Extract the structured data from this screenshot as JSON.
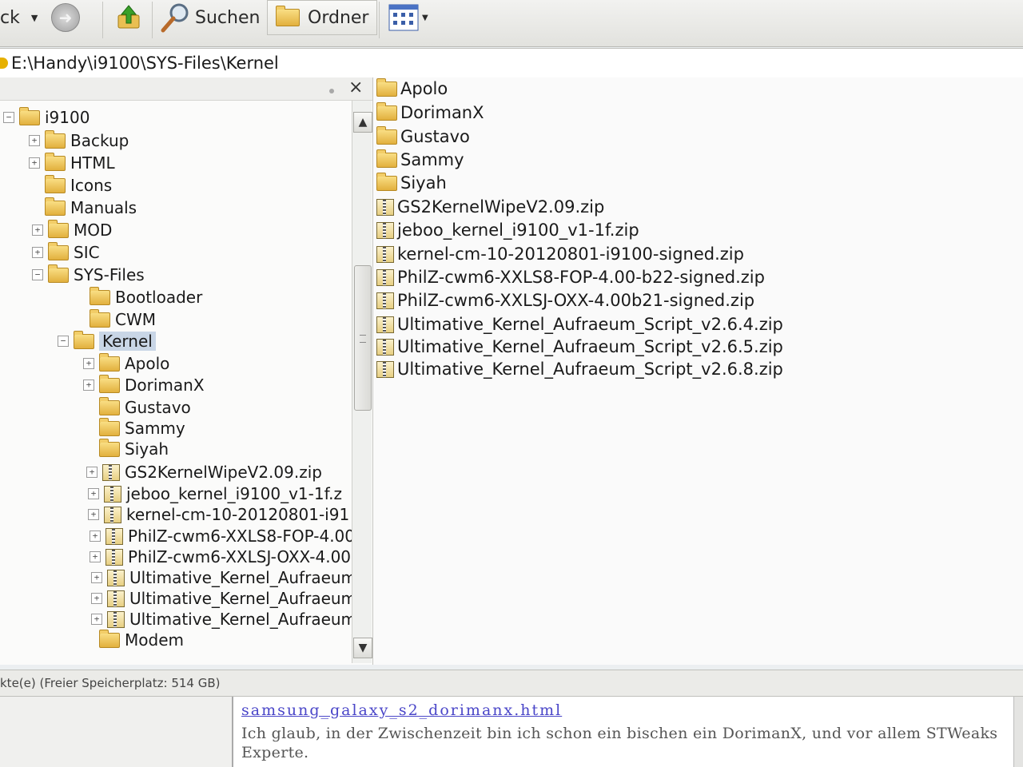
{
  "toolbar": {
    "back_fragment": "ck",
    "search_label": "Suchen",
    "folders_label": "Ordner",
    "icons": {
      "back_dropdown": "chevron-down-icon",
      "forward": "forward-arrow-icon",
      "up": "folder-up-icon",
      "search": "magnifier-icon",
      "folders": "folder-icon",
      "views": "view-grid-icon"
    }
  },
  "address": {
    "path": "E:\\Handy\\i9100\\SYS-Files\\Kernel"
  },
  "folder_pane": {
    "close_glyph": "×",
    "tree": [
      {
        "label": "i9100",
        "expander": "−",
        "type": "folder"
      },
      {
        "label": "Backup",
        "expander": "+",
        "type": "folder"
      },
      {
        "label": "HTML",
        "expander": "+",
        "type": "folder"
      },
      {
        "label": "Icons",
        "expander": "",
        "type": "folder"
      },
      {
        "label": "Manuals",
        "expander": "",
        "type": "folder"
      },
      {
        "label": "MOD",
        "expander": "+",
        "type": "folder"
      },
      {
        "label": "SIC",
        "expander": "+",
        "type": "folder"
      },
      {
        "label": "SYS-Files",
        "expander": "−",
        "type": "folder"
      },
      {
        "label": "Bootloader",
        "expander": "",
        "type": "folder"
      },
      {
        "label": "CWM",
        "expander": "",
        "type": "folder"
      },
      {
        "label": "Kernel",
        "expander": "−",
        "type": "folder",
        "selected": true
      },
      {
        "label": "Apolo",
        "expander": "+",
        "type": "folder"
      },
      {
        "label": "DorimanX",
        "expander": "+",
        "type": "folder"
      },
      {
        "label": "Gustavo",
        "expander": "",
        "type": "folder"
      },
      {
        "label": "Sammy",
        "expander": "",
        "type": "folder"
      },
      {
        "label": "Siyah",
        "expander": "",
        "type": "folder"
      },
      {
        "label": "GS2KernelWipeV2.09.zip",
        "expander": "+",
        "type": "zip"
      },
      {
        "label": "jeboo_kernel_i9100_v1-1f.z",
        "expander": "+",
        "type": "zip"
      },
      {
        "label": "kernel-cm-10-20120801-i91",
        "expander": "+",
        "type": "zip"
      },
      {
        "label": "PhilZ-cwm6-XXLS8-FOP-4.00",
        "expander": "+",
        "type": "zip"
      },
      {
        "label": "PhilZ-cwm6-XXLSJ-OXX-4.00",
        "expander": "+",
        "type": "zip"
      },
      {
        "label": "Ultimative_Kernel_Aufraeum",
        "expander": "+",
        "type": "zip"
      },
      {
        "label": "Ultimative_Kernel_Aufraeum",
        "expander": "+",
        "type": "zip"
      },
      {
        "label": "Ultimative_Kernel_Aufraeum",
        "expander": "+",
        "type": "zip"
      },
      {
        "label": "Modem",
        "expander": "",
        "type": "folder"
      }
    ]
  },
  "file_list": [
    {
      "name": "Apolo",
      "type": "folder"
    },
    {
      "name": "DorimanX",
      "type": "folder"
    },
    {
      "name": "Gustavo",
      "type": "folder"
    },
    {
      "name": "Sammy",
      "type": "folder"
    },
    {
      "name": "Siyah",
      "type": "folder"
    },
    {
      "name": "GS2KernelWipeV2.09.zip",
      "type": "zip"
    },
    {
      "name": "jeboo_kernel_i9100_v1-1f.zip",
      "type": "zip"
    },
    {
      "name": "kernel-cm-10-20120801-i9100-signed.zip",
      "type": "zip"
    },
    {
      "name": "PhilZ-cwm6-XXLS8-FOP-4.00-b22-signed.zip",
      "type": "zip"
    },
    {
      "name": "PhilZ-cwm6-XXLSJ-OXX-4.00b21-signed.zip",
      "type": "zip"
    },
    {
      "name": "Ultimative_Kernel_Aufraeum_Script_v2.6.4.zip",
      "type": "zip"
    },
    {
      "name": "Ultimative_Kernel_Aufraeum_Script_v2.6.5.zip",
      "type": "zip"
    },
    {
      "name": "Ultimative_Kernel_Aufraeum_Script_v2.6.8.zip",
      "type": "zip"
    }
  ],
  "status": {
    "text": "kte(e) (Freier Speicherplatz: 514 GB)"
  },
  "browser": {
    "link": "samsung_galaxy_s2_dorimanx.html",
    "text": "Ich glaub, in der Zwischenzeit bin ich schon ein bischen ein DorimanX, und vor allem STWeaks Experte."
  }
}
